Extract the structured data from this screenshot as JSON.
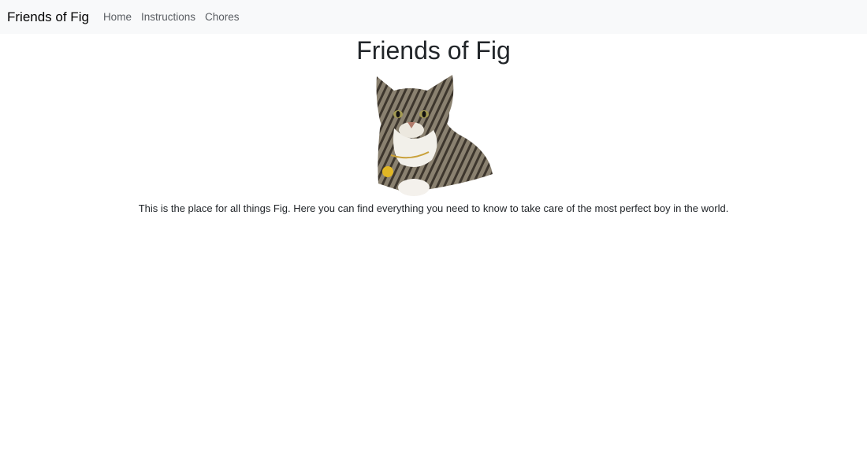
{
  "navbar": {
    "brand": "Friends of Fig",
    "links": [
      {
        "label": "Home"
      },
      {
        "label": "Instructions"
      },
      {
        "label": "Chores"
      }
    ]
  },
  "main": {
    "title": "Friends of Fig",
    "intro": "This is the place for all things Fig. Here you can find everything you need to know to take care of the most perfect boy in the world."
  },
  "colors": {
    "navbar_bg": "#f8f9fa",
    "text": "#212529",
    "link": "#595d62"
  }
}
